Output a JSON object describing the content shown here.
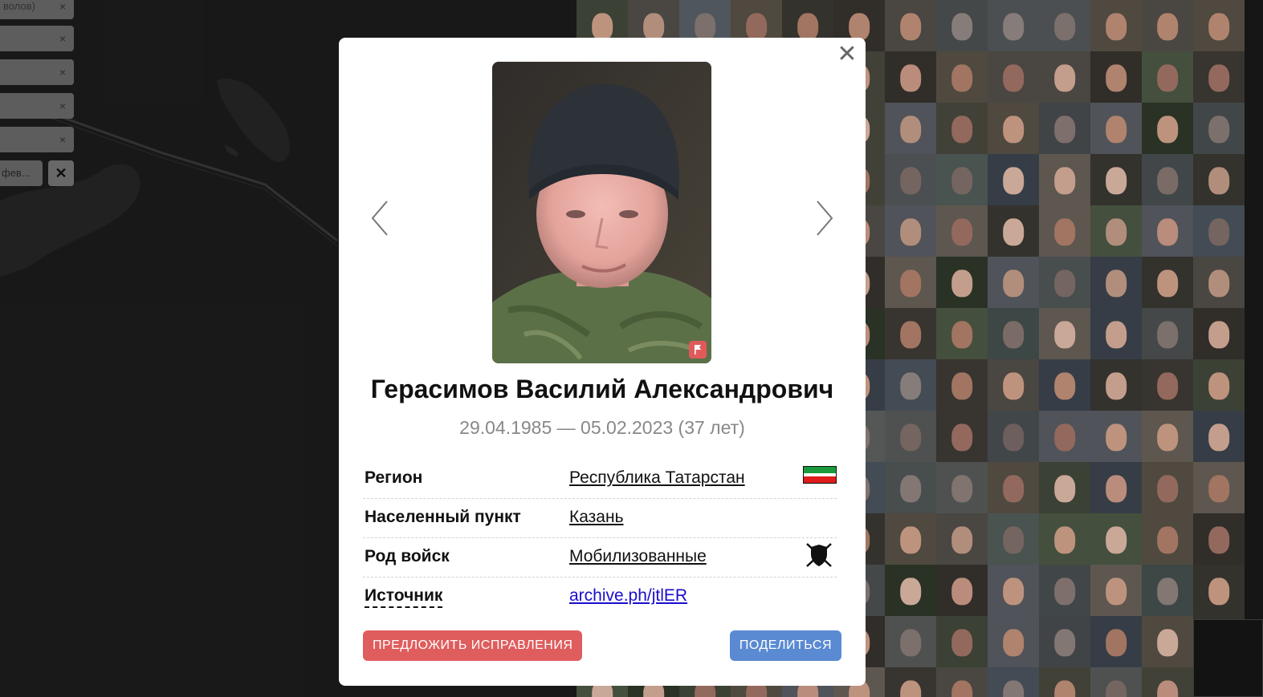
{
  "filters": {
    "chips": [
      {
        "label": "волов)"
      },
      {
        "label": ""
      },
      {
        "label": ""
      },
      {
        "label": ""
      },
      {
        "label": ""
      }
    ],
    "chip_close_glyph": "×",
    "last_chip_label": "фев...",
    "clear_glyph": "✕"
  },
  "modal": {
    "close_glyph": "✕",
    "person": {
      "name": "Герасимов Василий Александрович",
      "dates": "29.04.1985 — 05.02.2023 (37 лет)"
    },
    "rows": [
      {
        "label": "Регион",
        "value": "Республика Татарстан",
        "icon": "tatarstan-flag-icon"
      },
      {
        "label": "Населенный пункт",
        "value": "Казань"
      },
      {
        "label": "Род войск",
        "value": "Мобилизованные",
        "icon": "shield-swords-icon"
      },
      {
        "label": "Источник",
        "value": "archive.ph/jtlER"
      }
    ],
    "suggest_label": "ПРЕДЛОЖИТЬ ИСПРАВЛЕНИЯ",
    "share_label": "ПОДЕЛИТЬСЯ"
  },
  "colors": {
    "suggest_button": "#e05d5d",
    "share_button": "#5a8ad2",
    "flag_green": "#1a9a3c",
    "flag_red": "#e01b1b"
  }
}
